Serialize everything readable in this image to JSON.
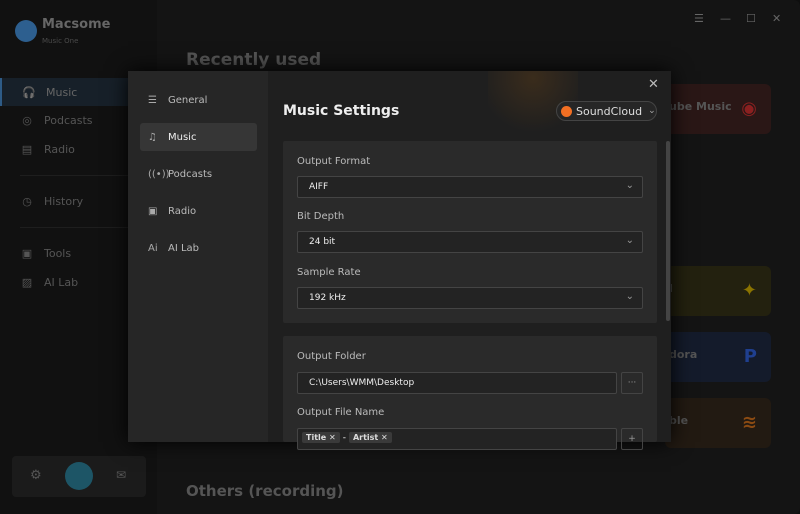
{
  "app": {
    "name": "Macsome",
    "subtitle": "Music One"
  },
  "sidebar": {
    "items": [
      {
        "label": "Music",
        "icon": "headphones-icon"
      },
      {
        "label": "Podcasts",
        "icon": "podcast-icon"
      },
      {
        "label": "Radio",
        "icon": "radio-icon"
      },
      {
        "label": "History",
        "icon": "clock-icon"
      },
      {
        "label": "Tools",
        "icon": "toolbox-icon"
      },
      {
        "label": "AI Lab",
        "icon": "ai-icon"
      }
    ]
  },
  "main": {
    "recent_title": "Recently used",
    "others_title": "Others (recording)",
    "cards": [
      {
        "label": "ube Music",
        "color": "#c62828"
      },
      {
        "label": "l",
        "color": "#c9a400"
      },
      {
        "label": "dora",
        "color": "#1f4fc8"
      },
      {
        "label": "ble",
        "color": "#d87a1c"
      }
    ]
  },
  "modal": {
    "title": "Music Settings",
    "nav": [
      {
        "label": "General"
      },
      {
        "label": "Music"
      },
      {
        "label": "Podcasts"
      },
      {
        "label": "Radio"
      },
      {
        "label": "AI Lab"
      }
    ],
    "service": "SoundCloud",
    "output_format": {
      "label": "Output Format",
      "value": "AIFF"
    },
    "bit_depth": {
      "label": "Bit Depth",
      "value": "24 bit"
    },
    "sample_rate": {
      "label": "Sample Rate",
      "value": "192 kHz"
    },
    "output_folder": {
      "label": "Output Folder",
      "value": "C:\\Users\\WMM\\Desktop",
      "browse": "···"
    },
    "file_name": {
      "label": "Output File Name",
      "tags": [
        "Title",
        "Artist"
      ],
      "separator": "-",
      "add": "+"
    }
  }
}
